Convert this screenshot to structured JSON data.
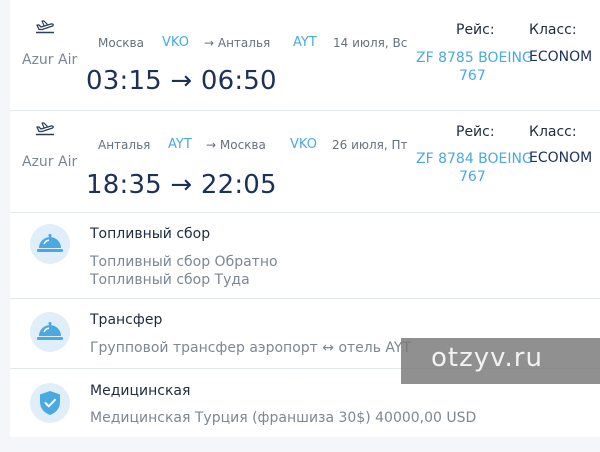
{
  "flights": [
    {
      "airline": "Azur Air",
      "from_city": "Москва",
      "from_code": "VKO",
      "to_city": "→ Анталья",
      "to_code": "AYT",
      "date": "14 июля, Вс",
      "times": "03:15 → 06:50",
      "flight_label": "Рейс:",
      "flight_number": "ZF 8785 BOEING",
      "aircraft": "767",
      "class_label": "Класс:",
      "class_value": "ECONOM"
    },
    {
      "airline": "Azur Air",
      "from_city": "Анталья",
      "from_code": "AYT",
      "to_city": "→ Москва",
      "to_code": "VKO",
      "date": "26 июля, Пт",
      "times": "18:35 → 22:05",
      "flight_label": "Рейс:",
      "flight_number": "ZF 8784 BOEING",
      "aircraft": "767",
      "class_label": "Класс:",
      "class_value": "ECONOM"
    }
  ],
  "services": [
    {
      "icon": "service-bell-icon",
      "title": "Топливный сбор",
      "lines": [
        "Топливный сбор Обратно",
        "Топливный сбор Туда"
      ]
    },
    {
      "icon": "service-bell-icon",
      "title": "Трансфер",
      "lines": [
        "Групповой трансфер аэропорт ↔ отель AYT"
      ]
    },
    {
      "icon": "shield-check-icon",
      "title": "Медицинская",
      "lines": [
        "Медицинская Турция (франшиза 30$) 40000,00 USD"
      ]
    }
  ],
  "watermark": "otzyv.ru",
  "colors": {
    "accent": "#4aa9e0",
    "time_text": "#1c3058",
    "icon_bg": "#dfeef8",
    "icon_fg": "#4aa9e0"
  }
}
